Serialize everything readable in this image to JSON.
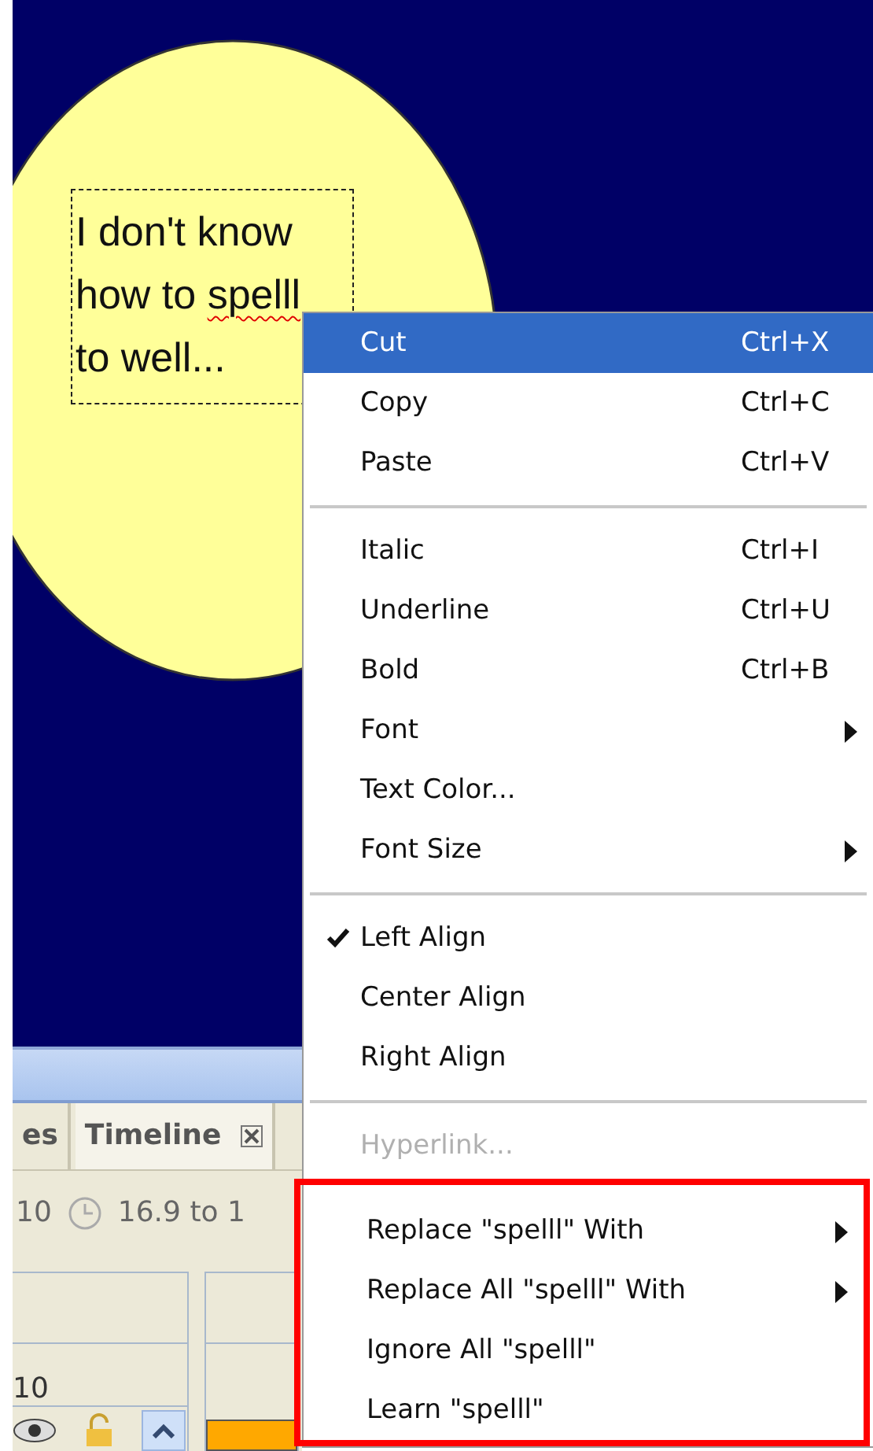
{
  "canvas": {
    "text_box": {
      "lines": [
        {
          "parts": [
            {
              "text": "I don't know",
              "misspelled": false
            }
          ]
        },
        {
          "parts": [
            {
              "text": "how to ",
              "misspelled": false
            },
            {
              "text": "spelll",
              "misspelled": true
            }
          ]
        },
        {
          "parts": [
            {
              "text": "to well...",
              "misspelled": false
            }
          ]
        }
      ]
    }
  },
  "panel": {
    "tabs": [
      {
        "label": "es",
        "selected": false,
        "closable": false
      },
      {
        "label": "Timeline",
        "selected": true,
        "closable": true
      }
    ],
    "frame_count": "10",
    "time_range": "16.9 to 1",
    "row_label": "10"
  },
  "context_menu": {
    "sections": [
      {
        "outlined": false,
        "items": [
          {
            "label": "Cut",
            "shortcut": "Ctrl+X",
            "selected": true,
            "checked": false,
            "disabled": false,
            "submenu": false
          },
          {
            "label": "Copy",
            "shortcut": "Ctrl+C",
            "selected": false,
            "checked": false,
            "disabled": false,
            "submenu": false
          },
          {
            "label": "Paste",
            "shortcut": "Ctrl+V",
            "selected": false,
            "checked": false,
            "disabled": false,
            "submenu": false
          }
        ]
      },
      {
        "outlined": false,
        "items": [
          {
            "label": "Italic",
            "shortcut": "Ctrl+I",
            "selected": false,
            "checked": false,
            "disabled": false,
            "submenu": false
          },
          {
            "label": "Underline",
            "shortcut": "Ctrl+U",
            "selected": false,
            "checked": false,
            "disabled": false,
            "submenu": false
          },
          {
            "label": "Bold",
            "shortcut": "Ctrl+B",
            "selected": false,
            "checked": false,
            "disabled": false,
            "submenu": false
          },
          {
            "label": "Font",
            "selected": false,
            "checked": false,
            "disabled": false,
            "submenu": true
          },
          {
            "label": "Text Color...",
            "selected": false,
            "checked": false,
            "disabled": false,
            "submenu": false
          },
          {
            "label": "Font Size",
            "selected": false,
            "checked": false,
            "disabled": false,
            "submenu": true
          }
        ]
      },
      {
        "outlined": false,
        "items": [
          {
            "label": "Left Align",
            "selected": false,
            "checked": true,
            "disabled": false,
            "submenu": false
          },
          {
            "label": "Center Align",
            "selected": false,
            "checked": false,
            "disabled": false,
            "submenu": false
          },
          {
            "label": "Right Align",
            "selected": false,
            "checked": false,
            "disabled": false,
            "submenu": false
          }
        ]
      },
      {
        "outlined": false,
        "items": [
          {
            "label": "Hyperlink...",
            "selected": false,
            "checked": false,
            "disabled": true,
            "submenu": false
          }
        ]
      },
      {
        "outlined": true,
        "items": [
          {
            "label": "Replace \"spelll\" With",
            "selected": false,
            "checked": false,
            "disabled": false,
            "submenu": true
          },
          {
            "label": "Replace All \"spelll\" With",
            "selected": false,
            "checked": false,
            "disabled": false,
            "submenu": true
          },
          {
            "label": "Ignore All \"spelll\"",
            "selected": false,
            "checked": false,
            "disabled": false,
            "submenu": false
          },
          {
            "label": "Learn \"spelll\"",
            "selected": false,
            "checked": false,
            "disabled": false,
            "submenu": false
          }
        ]
      }
    ]
  }
}
